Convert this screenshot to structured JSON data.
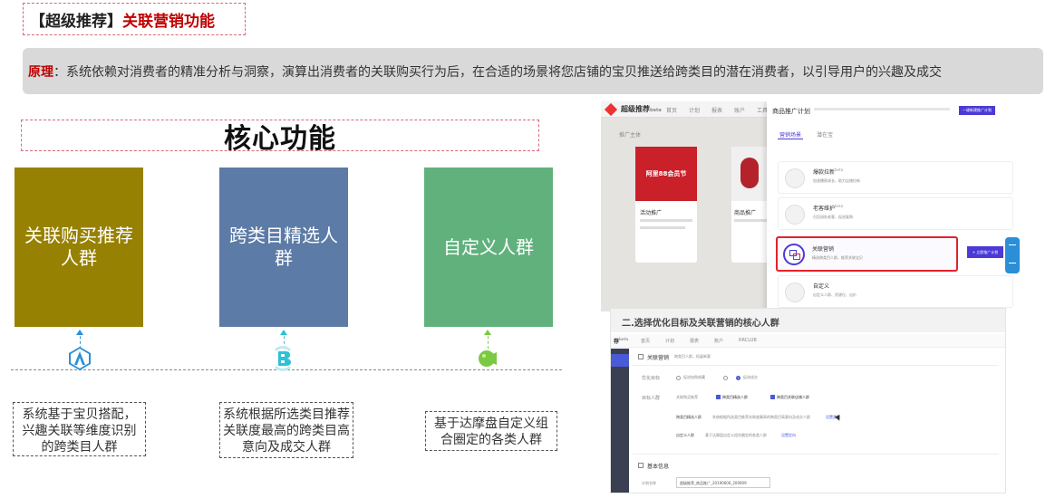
{
  "header": {
    "bracket_text": "【超级推荐】",
    "title_red": "关联营销功能"
  },
  "principle": {
    "label": "原理",
    "text": "：系统依赖对消费者的精准分析与洞察，演算出消费者的关联购买行为后，在合适的场景将您店铺的宝贝推送给跨类目的潜在消费者，以引导用户的兴趣及成交"
  },
  "core": {
    "title": "核心功能"
  },
  "functions": [
    {
      "label": "关联购买推荐 人群",
      "color": "#978102",
      "icon": "a-hexagon-icon",
      "description": "系统基于宝贝搭配，兴趣关联等维度识别的跨类目人群"
    },
    {
      "label": "跨类目精选人群",
      "color": "#5c7ba6",
      "icon": "b-ring-icon",
      "description": "系统根据所选类目推荐关联度最高的跨类目高意向及成交人群"
    },
    {
      "label": "自定义人群",
      "color": "#61b17d",
      "icon": "c-tag-icon",
      "description": "基于达摩盘自定义组合圈定的各类人群"
    }
  ],
  "screenshot1": {
    "logo": "超级推荐",
    "logo_sup": "beta",
    "nav": [
      "首页",
      "计划",
      "报表",
      "账户",
      "工具"
    ],
    "left_label": "推广主体",
    "cards": [
      {
        "title": "活动推广",
        "banner": "阿里88会员节"
      },
      {
        "title": "商品推广"
      }
    ],
    "panel_header": "商品推广计划",
    "panel_tabs": [
      "营销场景",
      "潜在宝"
    ],
    "options": [
      {
        "title": "爆款拉新",
        "sup": "beta",
        "desc": "加速爆款成长，助力店铺拉新"
      },
      {
        "title": "老客维护",
        "sup": "beta",
        "desc": "召回流失老客，促进复购"
      },
      {
        "title": "关联营销",
        "desc": "精选跨类目人群，推荐关联宝贝"
      },
      {
        "title": "自定义",
        "desc": "自定义人群、资源位、出价"
      }
    ],
    "create_button": "一键新建推广计划",
    "float_button": "+ 立即推广计划"
  },
  "screenshot2": {
    "heading": "二.选择优化目标及关联营销的核心人群",
    "logo_sup": "beta",
    "nav": [
      "首页",
      "计划",
      "报表",
      "账户",
      "RRCLUB"
    ],
    "section_title": "关联营销",
    "section_sub": "跨类目人群，拓展新客",
    "target_label": "优化目标",
    "target_options": [
      "促进加购收藏",
      "促进成交"
    ],
    "crowd_label": "目标人群",
    "crowd_options": [
      "关联购买推荐",
      "跨类目精选人群",
      "跨类目关联店铺人群"
    ],
    "row_cross_label": "跨类目精选人群",
    "row_cross_desc": "系统根据所选类目推荐关联度最高的跨类目高意向及成交人群",
    "row_cross_link": "设置类目",
    "row_custom_label": "自定义人群",
    "row_custom_desc": "基于达摩盘自定义组合圈定的各类人群",
    "row_custom_link": "设置定向",
    "basic_title": "基本信息",
    "plan_label": "计划名称",
    "plan_value": "超级推荐_商品推广_20190606_200909"
  }
}
